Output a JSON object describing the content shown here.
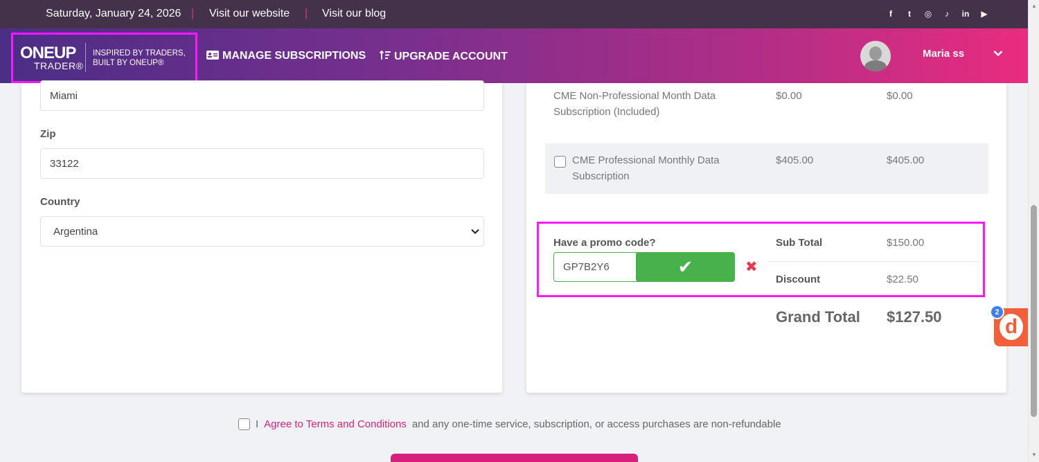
{
  "topbar": {
    "date": "Saturday, January 24, 2026",
    "separator": "|",
    "links": [
      "Visit our website",
      "Visit our blog"
    ],
    "social_icons": [
      "facebook-icon",
      "twitter-icon",
      "instagram-icon",
      "tiktok-icon",
      "linkedin-icon",
      "youtube-icon"
    ],
    "social_glyphs": [
      "f",
      "t",
      "◎",
      "♪",
      "in",
      "▶"
    ]
  },
  "navbar": {
    "logo_main": "ONEUP",
    "logo_sub": "TRADER®",
    "logo_tagline_1": "INSPIRED BY TRADERS,",
    "logo_tagline_2": "BUILT BY ONEUP®",
    "manage_label": "MANAGE SUBSCRIPTIONS",
    "upgrade_label": "UPGRADE ACCOUNT",
    "username": "Maria ss",
    "chevron": "⌄"
  },
  "form": {
    "city_value": "Miami",
    "zip_label": "Zip",
    "zip_value": "33122",
    "country_label": "Country",
    "country_value": "Argentina"
  },
  "order": {
    "rows": [
      {
        "name_line1": "CME Non-Professional Month Data",
        "name_line2": "Subscription (Included)",
        "price": "$0.00",
        "total": "$0.00"
      },
      {
        "name_line1": "CME Professional Monthly Data",
        "name_line2": "Subscription",
        "price": "$405.00",
        "total": "$405.00"
      }
    ],
    "promo_label": "Have a promo code?",
    "promo_value": "GP7B2Y6",
    "promo_check": "✔",
    "promo_remove": "✖",
    "subtotal_label": "Sub Total",
    "subtotal_value": "$150.00",
    "discount_label": "Discount",
    "discount_value": "$22.50",
    "grand_total_label": "Grand Total",
    "grand_total_value": "$127.50"
  },
  "widget": {
    "letter": "d",
    "badge_count": "2"
  },
  "terms": {
    "prefix": "I",
    "link_text": "Agree to Terms and Conditions",
    "suffix": "and any one-time service, subscription, or access purchases are non-refundable"
  },
  "colors": {
    "accent": "#d6217c",
    "highlight": "#ff19ff",
    "success": "#48b14b",
    "danger": "#e53950"
  }
}
